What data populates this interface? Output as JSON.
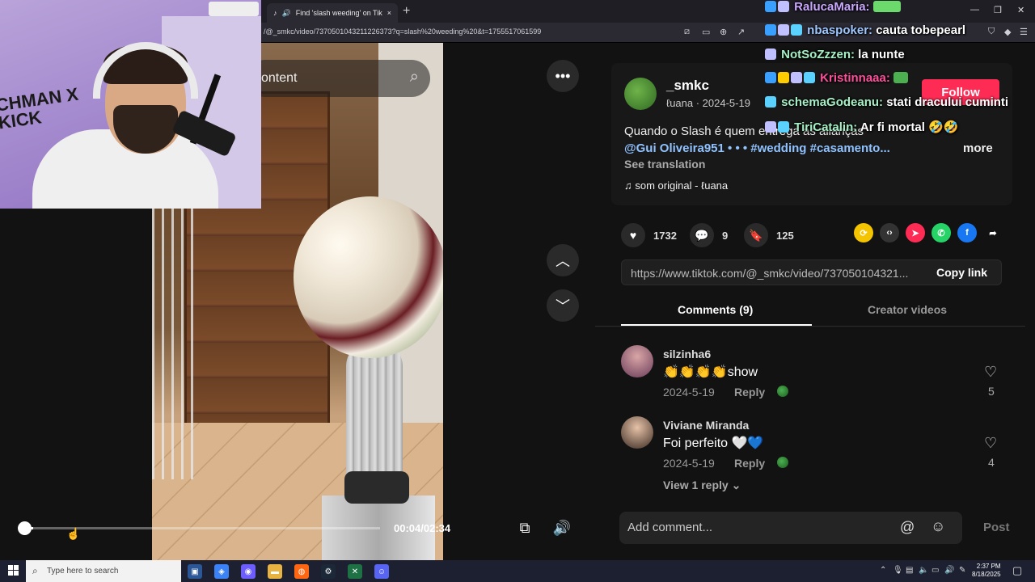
{
  "browser": {
    "tab_title": "Find 'slash weeding' on TikTo",
    "url": "/@_smkc/video/7370501043211226373?q=slash%20weeding%20&t=1755517061599",
    "new_tab": "+",
    "close_tab": "×"
  },
  "video": {
    "search_placeholder": "ontent",
    "time": "00:04/02:34",
    "progress_fraction": 0.026
  },
  "webcam": {
    "logo_text": "CHMAN X KICK"
  },
  "post": {
    "username": "_smkc",
    "subline": "ℓuana · 2024-5-19",
    "follow_label": "Follow",
    "caption": "Quando o Slash é quem entrega as alianças",
    "tags": "@Gui Oliveira951 • • • #wedding #casamento...",
    "more_label": "more",
    "see_translation": "See translation",
    "music": "som original - ℓuana"
  },
  "actions": {
    "likes": "1732",
    "comments": "9",
    "saves": "125"
  },
  "share": {
    "link": "https://www.tiktok.com/@_smkc/video/737050104321...",
    "copy_label": "Copy link"
  },
  "tabs": {
    "comments_label": "Comments (9)",
    "creator_label": "Creator videos"
  },
  "comments": [
    {
      "name": "silzinha6",
      "text": "👏👏👏👏show",
      "date": "2024-5-19",
      "reply": "Reply",
      "likes": "5"
    },
    {
      "name": "Viviane Miranda",
      "text": "Foi perfeito 🤍💙",
      "date": "2024-5-19",
      "reply": "Reply",
      "likes": "4"
    }
  ],
  "view_reply": "View 1 reply ⌄",
  "comment_input": {
    "placeholder": "Add comment...",
    "post_label": "Post",
    "at_symbol": "@",
    "emoji_symbol": "☺"
  },
  "chat": [
    {
      "user": "RalucaMaria:",
      "msg": "",
      "color": "#c9a7ff"
    },
    {
      "user": "nbaspoker:",
      "msg": "cauta tobepearl",
      "color": "#9fc7ff"
    },
    {
      "user": "NotSoZzzen:",
      "msg": "la nunte",
      "color": "#a6f0c6"
    },
    {
      "user": "Kristinnaaa:",
      "msg": "",
      "color": "#ff4f9a"
    },
    {
      "user": "schemaGodeanu:",
      "msg": "stati dracului cuminti",
      "color": "#a6f0c6"
    },
    {
      "user": "TiriCatalin:",
      "msg": "Ar fi mortal 🤣🤣",
      "color": "#a6f0c6"
    }
  ],
  "taskbar": {
    "search_placeholder": "Type here to search",
    "time": "2:37 PM",
    "date": "8/18/2025"
  },
  "colors": {
    "follow": "#fe2c55",
    "tag": "#8fc2ff",
    "panel_bg": "#121212"
  }
}
